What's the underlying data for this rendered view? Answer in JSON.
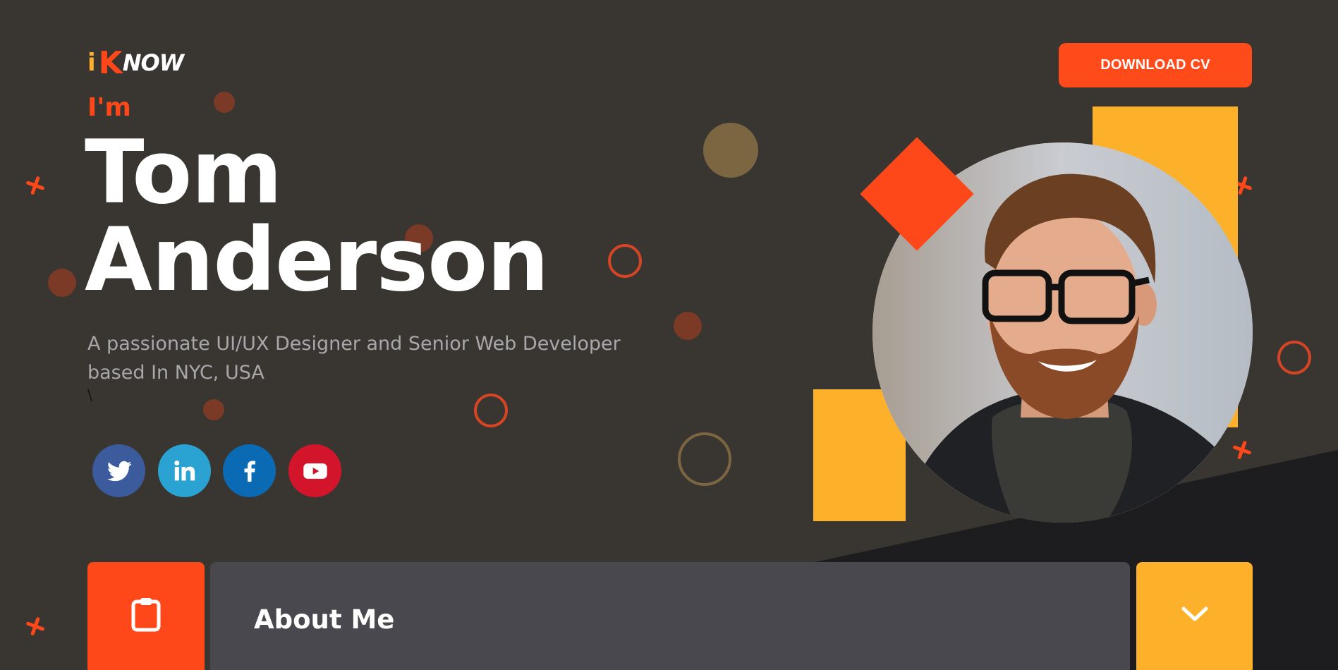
{
  "header": {
    "logo": {
      "i": "i",
      "k": "K",
      "now": "NOW"
    },
    "download_cv": "DOWNLOAD CV"
  },
  "hero": {
    "intro": "I'm",
    "name_line1": "Tom",
    "name_line2": "Anderson",
    "tagline_line1": "A passionate UI/UX Designer and Senior Web Developer",
    "tagline_line2": "based In NYC, USA",
    "stray_char": "\\",
    "portrait_icon": "portrait-photo"
  },
  "social": [
    {
      "name": "Twitter",
      "icon": "twitter-icon",
      "color": "#3b5b9c"
    },
    {
      "name": "LinkedIn",
      "icon": "linkedin-icon",
      "color": "#2aa3d3"
    },
    {
      "name": "Facebook",
      "icon": "facebook-icon",
      "color": "#0a6ab4"
    },
    {
      "name": "YouTube",
      "icon": "youtube-icon",
      "color": "#d3152c"
    }
  ],
  "about": {
    "icon": "clipboard-icon",
    "title": "About Me",
    "toggle_icon": "chevron-down-icon"
  },
  "colors": {
    "background": "#393632",
    "accent": "#ff4819",
    "yellow": "#fdb12a",
    "panel": "#48484e",
    "dark": "#1d1c1e"
  }
}
